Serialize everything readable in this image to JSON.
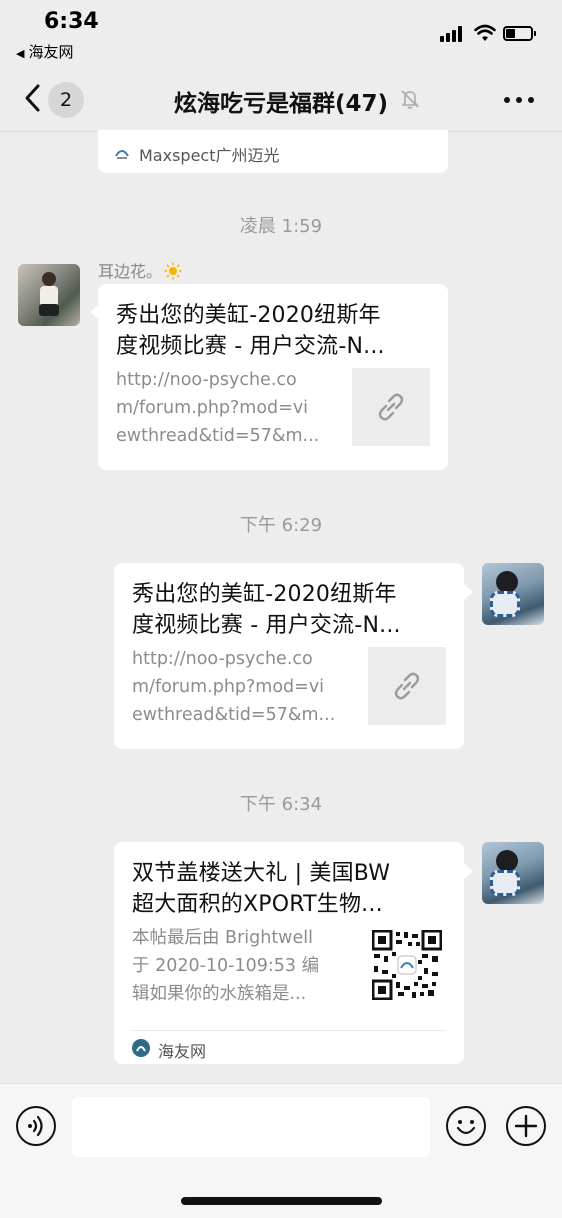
{
  "status_bar": {
    "time": "6:34",
    "back_app": "海友网",
    "back_arrow": "◀"
  },
  "nav": {
    "back_count": "2",
    "title": "炫海吃亏是福群",
    "member_count": "(47)"
  },
  "top_card": {
    "source": "Maxspect广州迈光"
  },
  "messages": [
    {
      "timestamp": "凌晨 1:59",
      "sender": "耳边花。",
      "title": "秀出您的美缸-2020纽斯年度视频比赛 - 用户交流-N...",
      "title_line1": "秀出您的美缸-2020纽斯年",
      "title_line2": "度视频比赛 - 用户交流-N...",
      "desc_line1": "http://noo-psyche.co",
      "desc_line2": "m/forum.php?mod=vi",
      "desc_line3": "ewthread&tid=57&m..."
    },
    {
      "timestamp": "下午 6:29",
      "title_line1": "秀出您的美缸-2020纽斯年",
      "title_line2": "度视频比赛 - 用户交流-N...",
      "desc_line1": "http://noo-psyche.co",
      "desc_line2": "m/forum.php?mod=vi",
      "desc_line3": "ewthread&tid=57&m..."
    },
    {
      "timestamp": "下午 6:34",
      "title_line1": "双节盖楼送大礼 | 美国BW",
      "title_line2": "超大面积的XPORT生物...",
      "desc_line1": "本帖最后由 Brightwell",
      "desc_line2": "于 2020-10-109:53 编",
      "desc_line3": "辑如果你的水族箱是...",
      "source": "海友网"
    }
  ],
  "input_bar": {
    "placeholder": ""
  },
  "icons": {
    "back": "chevron-left-icon",
    "mute": "bell-off-icon",
    "more": "more-icon",
    "link": "link-icon",
    "voice": "voice-icon",
    "emoji": "emoji-icon",
    "plus": "plus-icon"
  },
  "colors": {
    "background": "#ededed",
    "bubble": "#ffffff",
    "timestamp": "#9a9a9a"
  }
}
